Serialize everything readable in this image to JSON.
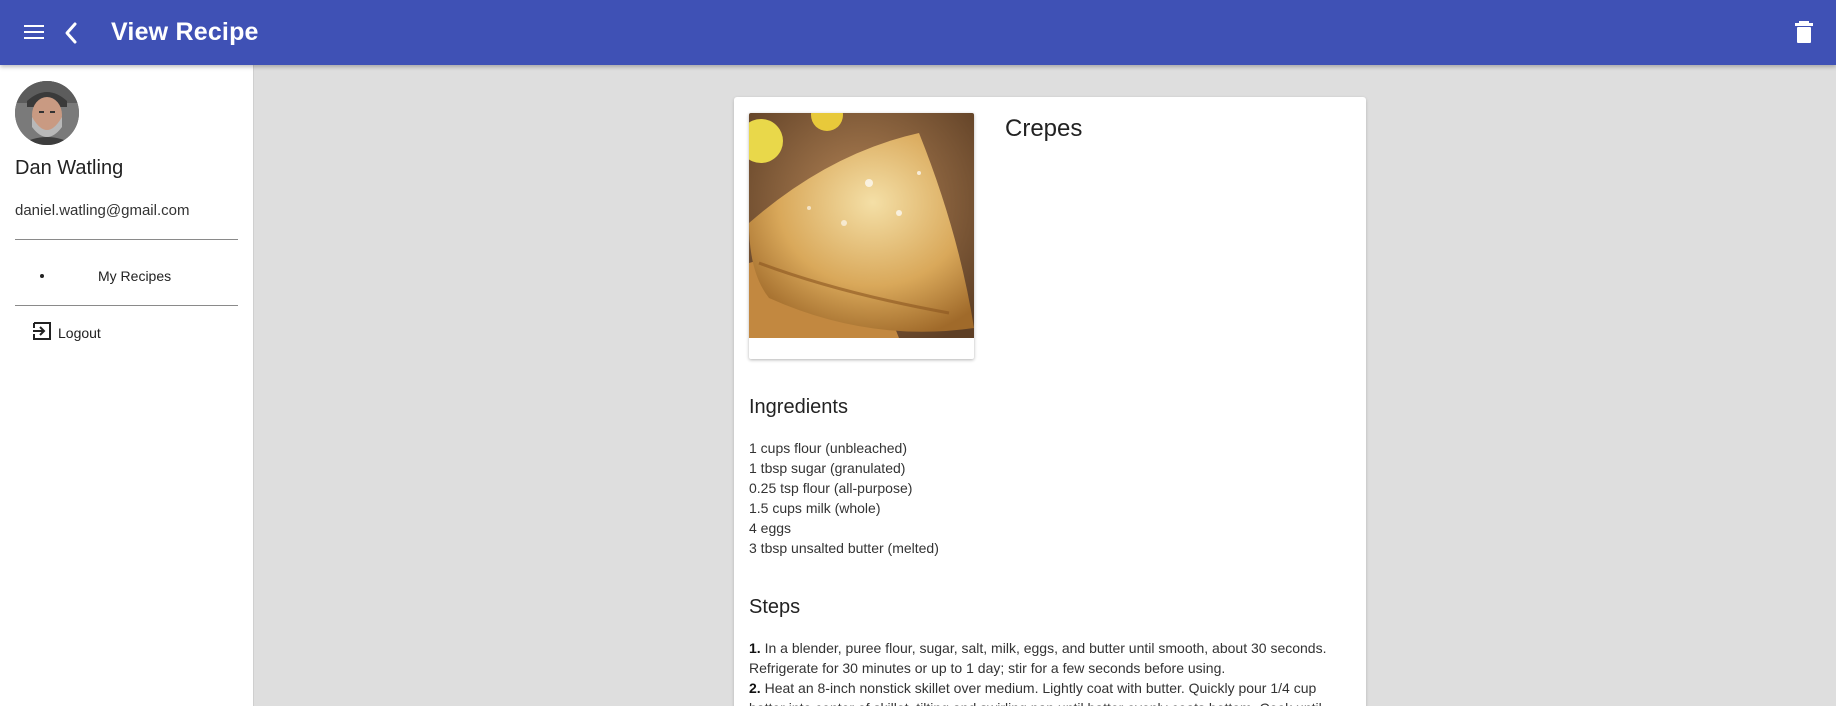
{
  "header": {
    "title": "View Recipe",
    "menu_icon": "menu-icon",
    "back_icon": "arrow-back-icon",
    "delete_icon": "trash-icon",
    "bg_color": "#3f51b5"
  },
  "sidebar": {
    "user": {
      "name": "Dan Watling",
      "email": "daniel.watling@gmail.com"
    },
    "nav": [
      {
        "label": "My Recipes"
      }
    ],
    "logout": {
      "label": "Logout",
      "icon": "logout-icon"
    }
  },
  "recipe": {
    "name": "Crepes",
    "ingredients_title": "Ingredients",
    "ingredients": [
      "1 cups flour (unbleached)",
      "1 tbsp sugar (granulated)",
      "0.25 tsp flour (all-purpose)",
      "1.5 cups milk (whole)",
      "4 eggs",
      "3 tbsp unsalted butter (melted)"
    ],
    "steps_title": "Steps",
    "steps": [
      {
        "num": "1.",
        "text": "In a blender, puree flour, sugar, salt, milk, eggs, and butter until smooth, about 30 seconds. Refrigerate for 30 minutes or up to 1 day; stir for a few seconds before using."
      },
      {
        "num": "2.",
        "text": "Heat an 8-inch nonstick skillet over medium. Lightly coat with butter. Quickly pour 1/4 cup batter into center of skillet, tilting and swirling pan until batter evenly coats bottom. Cook until"
      }
    ]
  }
}
